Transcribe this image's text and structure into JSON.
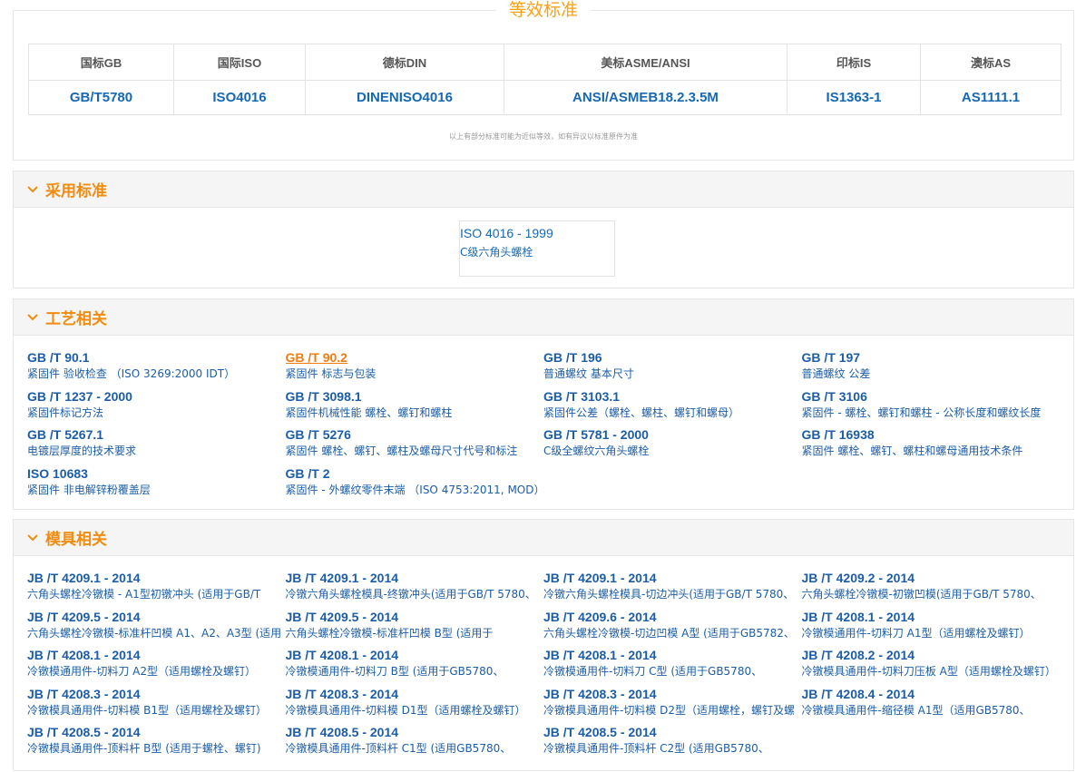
{
  "equivalent": {
    "title": "等效标准",
    "headers": [
      "国标GB",
      "国际ISO",
      "德标DIN",
      "美标ASME/ANSI",
      "印标IS",
      "澳标AS"
    ],
    "values": [
      "GB/T5780",
      "ISO4016",
      "DINENISO4016",
      "ANSI/ASMEB18.2.3.5M",
      "IS1363-1",
      "AS1111.1"
    ],
    "note": "以上有部分标准可能为近似等效，如有异议以标准原件为准"
  },
  "adopted": {
    "title": "采用标准",
    "code": "ISO 4016 - 1999",
    "name": "C级六角头螺栓"
  },
  "process": {
    "title": "工艺相关",
    "items": [
      {
        "code": "GB /T 90.1",
        "name": "紧固件 验收检查 （ISO 3269:2000 IDT）",
        "active": false
      },
      {
        "code": "GB /T 90.2",
        "name": "紧固件 标志与包装",
        "active": true
      },
      {
        "code": "GB /T 196",
        "name": "普通螺纹 基本尺寸",
        "active": false
      },
      {
        "code": "GB /T 197",
        "name": "普通螺纹 公差",
        "active": false
      },
      {
        "code": "GB /T 1237 - 2000",
        "name": "紧固件标记方法",
        "active": false
      },
      {
        "code": "GB /T 3098.1",
        "name": "紧固件机械性能 螺栓、螺钉和螺柱",
        "active": false
      },
      {
        "code": "GB /T 3103.1",
        "name": "紧固件公差（螺栓、螺柱、螺钉和螺母）",
        "active": false
      },
      {
        "code": "GB /T 3106",
        "name": "紧固件 - 螺栓、螺钉和螺柱 - 公称长度和螺纹长度",
        "active": false
      },
      {
        "code": "GB /T 5267.1",
        "name": "电镀层厚度的技术要求",
        "active": false
      },
      {
        "code": "GB /T 5276",
        "name": "紧固件 螺栓、螺钉、螺柱及螺母尺寸代号和标注",
        "active": false
      },
      {
        "code": "GB /T 5781 - 2000",
        "name": "C级全螺纹六角头螺栓",
        "active": false
      },
      {
        "code": "GB /T 16938",
        "name": "紧固件 螺栓、螺钉、螺柱和螺母通用技术条件",
        "active": false
      },
      {
        "code": "ISO 10683",
        "name": "紧固件 非电解锌粉覆盖层",
        "active": false
      },
      {
        "code": "GB /T 2",
        "name": "紧固件 - 外螺纹零件末端 （ISO 4753:2011, MOD）",
        "active": false
      }
    ]
  },
  "mold": {
    "title": "模具相关",
    "items": [
      {
        "code": "JB /T 4209.1 - 2014",
        "name": "六角头螺栓冷镦模 - A1型初镦冲头 (适用于GB/T"
      },
      {
        "code": "JB /T 4209.1 - 2014",
        "name": "冷镦六角头螺栓模具-终镦冲头(适用于GB/T 5780、"
      },
      {
        "code": "JB /T 4209.1 - 2014",
        "name": "冷镦六角头螺栓模具-切边冲头(适用于GB/T 5780、"
      },
      {
        "code": "JB /T 4209.2 - 2014",
        "name": "六角头螺栓冷镦模-初镦凹模(适用于GB/T 5780、"
      },
      {
        "code": "JB /T 4209.5 - 2014",
        "name": "六角头螺栓冷镦模-标准杆凹模 A1、A2、A3型 (适用"
      },
      {
        "code": "JB /T 4209.5 - 2014",
        "name": "六角头螺栓冷镦模-标准杆凹模 B型 (适用于"
      },
      {
        "code": "JB /T 4209.6 - 2014",
        "name": "六角头螺栓冷镦模-切边凹模 A型 (适用于GB5782、"
      },
      {
        "code": "JB /T 4208.1 - 2014",
        "name": "冷镦模通用件-切料刀 A1型（适用螺栓及螺钉）"
      },
      {
        "code": "JB /T 4208.1 - 2014",
        "name": "冷镦模通用件-切料刀 A2型（适用螺栓及螺钉）"
      },
      {
        "code": "JB /T 4208.1 - 2014",
        "name": "冷镦模通用件-切料刀 B型 (适用于GB5780、"
      },
      {
        "code": "JB /T 4208.1 - 2014",
        "name": "冷镦模通用件-切料刀 C型 (适用于GB5780、"
      },
      {
        "code": "JB /T 4208.2 - 2014",
        "name": "冷镦模具通用件-切料刀压板 A型（适用螺栓及螺钉）"
      },
      {
        "code": "JB /T 4208.3 - 2014",
        "name": "冷镦模具通用件-切料模 B1型（适用螺栓及螺钉）"
      },
      {
        "code": "JB /T 4208.3 - 2014",
        "name": "冷镦模具通用件-切料模 D1型（适用螺栓及螺钉）"
      },
      {
        "code": "JB /T 4208.3 - 2014",
        "name": "冷镦模具通用件-切料模 D2型（适用螺栓，螺钉及螺"
      },
      {
        "code": "JB /T 4208.4 - 2014",
        "name": "冷镦模具通用件-缩径模 A1型（适用GB5780、"
      },
      {
        "code": "JB /T 4208.5 - 2014",
        "name": "冷镦模具通用件-顶料杆 B型 (适用于螺栓、螺钉)"
      },
      {
        "code": "JB /T 4208.5 - 2014",
        "name": "冷镦模具通用件-顶料杆 C1型 (适用GB5780、"
      },
      {
        "code": "JB /T 4208.5 - 2014",
        "name": "冷镦模具通用件-顶料杆 C2型 (适用GB5780、"
      }
    ]
  },
  "colors": {
    "accent": "#f08c10",
    "link": "#1c5da6",
    "active_link": "#f07c12"
  }
}
